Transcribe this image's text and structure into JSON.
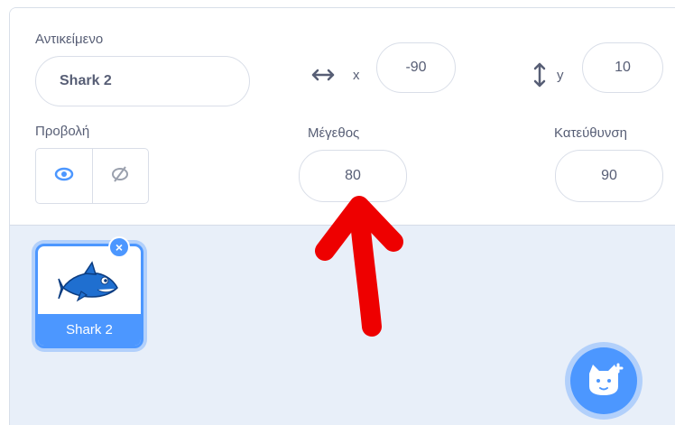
{
  "sprite_info": {
    "sprite_label": "Αντικείμενο",
    "sprite_name": "Shark 2",
    "x_label": "x",
    "x_value": "-90",
    "y_label": "y",
    "y_value": "10",
    "show_label": "Προβολή",
    "size_label": "Μέγεθος",
    "size_value": "80",
    "direction_label": "Κατεύθυνση",
    "direction_value": "90"
  },
  "sprite_list": {
    "items": [
      {
        "name": "Shark 2",
        "selected": true
      }
    ]
  },
  "colors": {
    "accent": "#4c97ff",
    "text": "#575e75",
    "annotation": "#ee0000"
  }
}
